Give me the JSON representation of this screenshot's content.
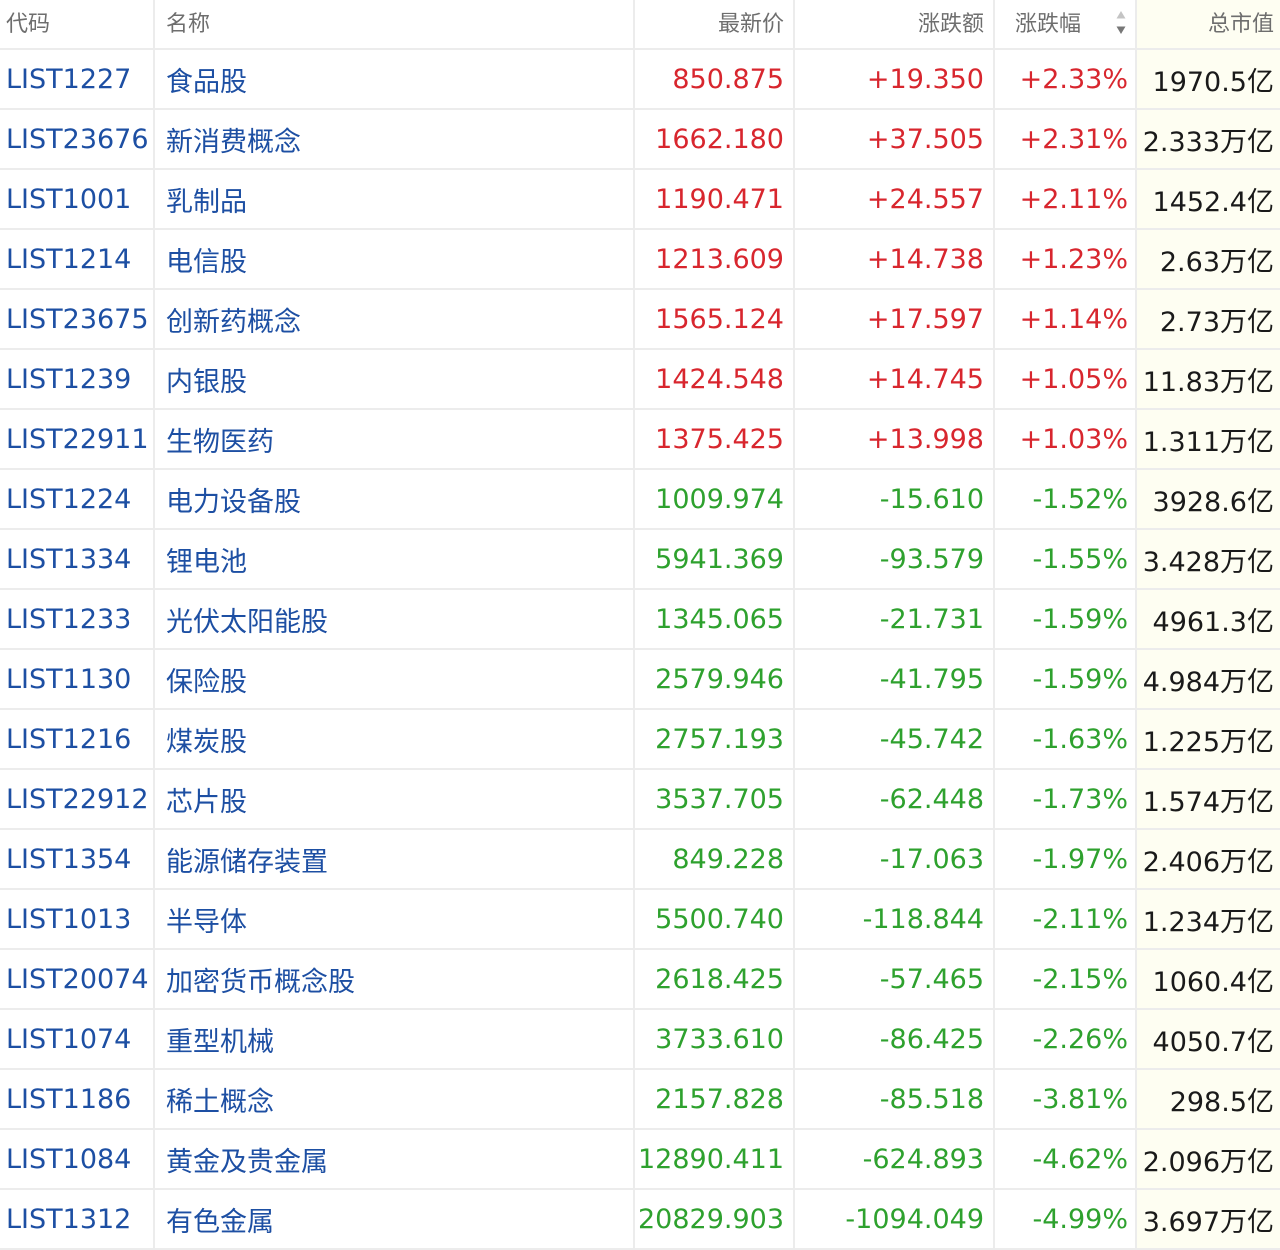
{
  "header": {
    "code": "代码",
    "name": "名称",
    "price": "最新价",
    "change": "涨跌额",
    "pct": "涨跌幅",
    "cap": "总市值"
  },
  "colors": {
    "up": "#d8262e",
    "down": "#2ea12e",
    "link": "#1d4fa3"
  },
  "sort_icon": "sort-updown-icon",
  "rows": [
    {
      "code": "LIST1227",
      "name": "食品股",
      "price": "850.875",
      "change": "+19.350",
      "pct": "+2.33%",
      "cap": "1970.5亿",
      "dir": "up"
    },
    {
      "code": "LIST23676",
      "name": "新消费概念",
      "price": "1662.180",
      "change": "+37.505",
      "pct": "+2.31%",
      "cap": "2.333万亿",
      "dir": "up"
    },
    {
      "code": "LIST1001",
      "name": "乳制品",
      "price": "1190.471",
      "change": "+24.557",
      "pct": "+2.11%",
      "cap": "1452.4亿",
      "dir": "up"
    },
    {
      "code": "LIST1214",
      "name": "电信股",
      "price": "1213.609",
      "change": "+14.738",
      "pct": "+1.23%",
      "cap": "2.63万亿",
      "dir": "up"
    },
    {
      "code": "LIST23675",
      "name": "创新药概念",
      "price": "1565.124",
      "change": "+17.597",
      "pct": "+1.14%",
      "cap": "2.73万亿",
      "dir": "up"
    },
    {
      "code": "LIST1239",
      "name": "内银股",
      "price": "1424.548",
      "change": "+14.745",
      "pct": "+1.05%",
      "cap": "11.83万亿",
      "dir": "up"
    },
    {
      "code": "LIST22911",
      "name": "生物医药",
      "price": "1375.425",
      "change": "+13.998",
      "pct": "+1.03%",
      "cap": "1.311万亿",
      "dir": "up"
    },
    {
      "code": "LIST1224",
      "name": "电力设备股",
      "price": "1009.974",
      "change": "-15.610",
      "pct": "-1.52%",
      "cap": "3928.6亿",
      "dir": "down"
    },
    {
      "code": "LIST1334",
      "name": "锂电池",
      "price": "5941.369",
      "change": "-93.579",
      "pct": "-1.55%",
      "cap": "3.428万亿",
      "dir": "down"
    },
    {
      "code": "LIST1233",
      "name": "光伏太阳能股",
      "price": "1345.065",
      "change": "-21.731",
      "pct": "-1.59%",
      "cap": "4961.3亿",
      "dir": "down"
    },
    {
      "code": "LIST1130",
      "name": "保险股",
      "price": "2579.946",
      "change": "-41.795",
      "pct": "-1.59%",
      "cap": "4.984万亿",
      "dir": "down"
    },
    {
      "code": "LIST1216",
      "name": "煤炭股",
      "price": "2757.193",
      "change": "-45.742",
      "pct": "-1.63%",
      "cap": "1.225万亿",
      "dir": "down"
    },
    {
      "code": "LIST22912",
      "name": "芯片股",
      "price": "3537.705",
      "change": "-62.448",
      "pct": "-1.73%",
      "cap": "1.574万亿",
      "dir": "down"
    },
    {
      "code": "LIST1354",
      "name": "能源储存装置",
      "price": "849.228",
      "change": "-17.063",
      "pct": "-1.97%",
      "cap": "2.406万亿",
      "dir": "down"
    },
    {
      "code": "LIST1013",
      "name": "半导体",
      "price": "5500.740",
      "change": "-118.844",
      "pct": "-2.11%",
      "cap": "1.234万亿",
      "dir": "down"
    },
    {
      "code": "LIST20074",
      "name": "加密货币概念股",
      "price": "2618.425",
      "change": "-57.465",
      "pct": "-2.15%",
      "cap": "1060.4亿",
      "dir": "down"
    },
    {
      "code": "LIST1074",
      "name": "重型机械",
      "price": "3733.610",
      "change": "-86.425",
      "pct": "-2.26%",
      "cap": "4050.7亿",
      "dir": "down"
    },
    {
      "code": "LIST1186",
      "name": "稀土概念",
      "price": "2157.828",
      "change": "-85.518",
      "pct": "-3.81%",
      "cap": "298.5亿",
      "dir": "down"
    },
    {
      "code": "LIST1084",
      "name": "黄金及贵金属",
      "price": "12890.411",
      "change": "-624.893",
      "pct": "-4.62%",
      "cap": "2.096万亿",
      "dir": "down"
    },
    {
      "code": "LIST1312",
      "name": "有色金属",
      "price": "20829.903",
      "change": "-1094.049",
      "pct": "-4.99%",
      "cap": "3.697万亿",
      "dir": "down"
    }
  ]
}
